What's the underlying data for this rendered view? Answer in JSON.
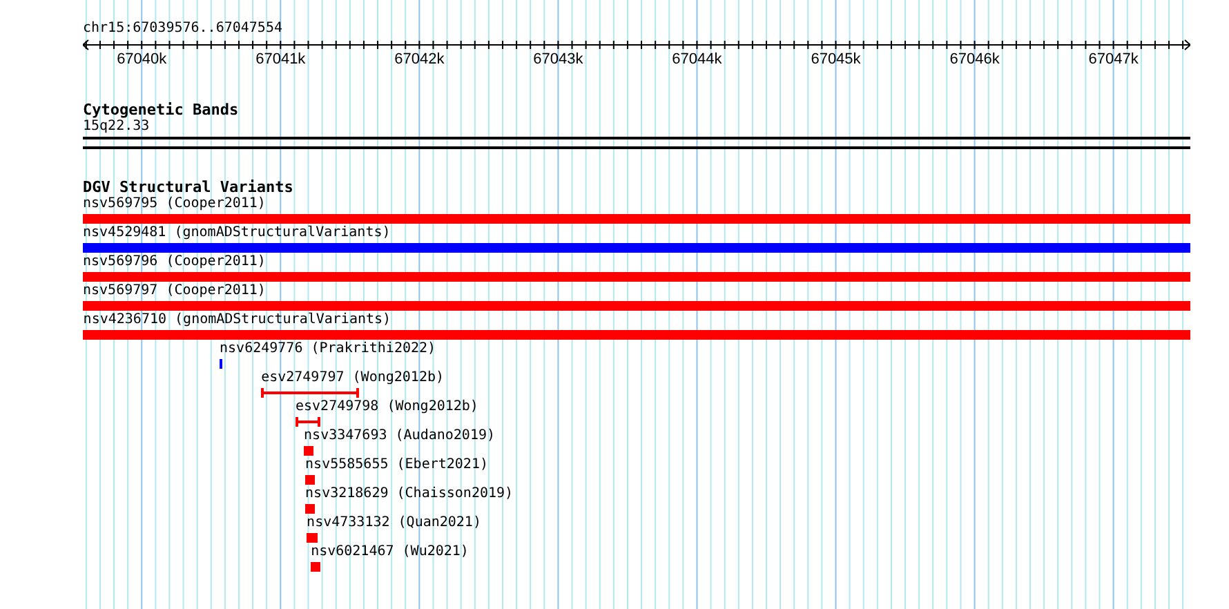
{
  "ruler": {
    "locus": "chr15:67039576..67047554",
    "ticks": [
      "67040k",
      "67041k",
      "67042k",
      "67043k",
      "67044k",
      "67045k",
      "67046k",
      "67047k"
    ]
  },
  "cytoband_track": {
    "title": "Cytogenetic Bands",
    "band": "15q22.33"
  },
  "dgv_track": {
    "title": "DGV Structural Variants",
    "features": [
      {
        "label": "nsv569795 (Cooper2011)",
        "kind": "bar",
        "color": "#ff0000"
      },
      {
        "label": "nsv4529481 (gnomADStructuralVariants)",
        "kind": "bar",
        "color": "#0000ff"
      },
      {
        "label": "nsv569796 (Cooper2011)",
        "kind": "bar",
        "color": "#ff0000"
      },
      {
        "label": "nsv569797 (Cooper2011)",
        "kind": "bar",
        "color": "#ff0000"
      },
      {
        "label": "nsv4236710 (gnomADStructuralVariants)",
        "kind": "bar",
        "color": "#ff0000"
      },
      {
        "label": "nsv6249776 (Prakrithi2022)",
        "kind": "bar",
        "color": "#0000ff"
      },
      {
        "label": "esv2749797 (Wong2012b)",
        "kind": "interval",
        "color": "#ff0000"
      },
      {
        "label": "esv2749798 (Wong2012b)",
        "kind": "interval",
        "color": "#ff0000"
      },
      {
        "label": "nsv3347693 (Audano2019)",
        "kind": "bar",
        "color": "#ff0000"
      },
      {
        "label": "nsv5585655 (Ebert2021)",
        "kind": "bar",
        "color": "#ff0000"
      },
      {
        "label": "nsv3218629 (Chaisson2019)",
        "kind": "bar",
        "color": "#ff0000"
      },
      {
        "label": "nsv4733132 (Quan2021)",
        "kind": "bar",
        "color": "#ff0000"
      },
      {
        "label": "nsv6021467 (Wu2021)",
        "kind": "bar",
        "color": "#ff0000"
      }
    ]
  }
}
